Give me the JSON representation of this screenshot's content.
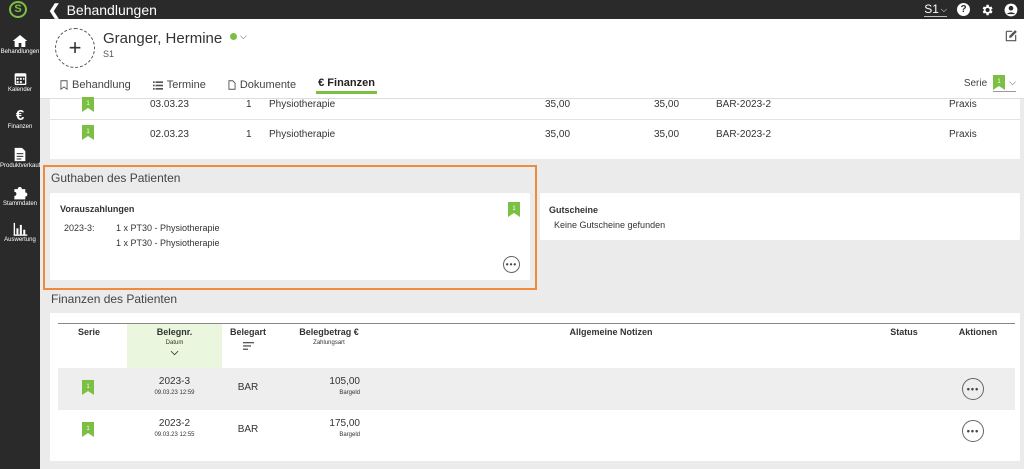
{
  "app": {
    "logo_letter": "S",
    "back_label": "Behandlungen",
    "user_selector": "S1",
    "icons": [
      "back-chevron-icon",
      "help-icon",
      "gear-icon",
      "user-icon"
    ]
  },
  "sidebar": {
    "items": [
      {
        "label": "Behandlungen",
        "icon": "home-icon"
      },
      {
        "label": "Kalender",
        "icon": "calendar-icon"
      },
      {
        "label": "Finanzen",
        "icon": "euro-icon"
      },
      {
        "label": "Produktverkauf",
        "icon": "document-icon"
      },
      {
        "label": "Stammdaten",
        "icon": "puzzle-icon"
      },
      {
        "label": "Auswertung",
        "icon": "bar-chart-icon"
      }
    ]
  },
  "patient": {
    "name": "Granger, Hermine",
    "code": "S1",
    "status_color": "#7bc043"
  },
  "tabs": [
    {
      "label": "Behandlung",
      "icon": "bookmark-outline-icon"
    },
    {
      "label": "Termine",
      "icon": "list-icon"
    },
    {
      "label": "Dokumente",
      "icon": "file-icon"
    },
    {
      "label": "€ Finanzen",
      "icon": "",
      "active": true
    }
  ],
  "serie": {
    "label": "Serie"
  },
  "top_rows": [
    {
      "date": "03.03.23",
      "qty": "1",
      "desc": "Physiotherapie",
      "price1": "35,00",
      "price2": "35,00",
      "ref": "BAR-2023-2",
      "loc": "Praxis"
    },
    {
      "date": "02.03.23",
      "qty": "1",
      "desc": "Physiotherapie",
      "price1": "35,00",
      "price2": "35,00",
      "ref": "BAR-2023-2",
      "loc": "Praxis"
    }
  ],
  "guthaben": {
    "title": "Guthaben des Patienten",
    "voraus": {
      "title": "Vorauszahlungen",
      "label": "2023-3:",
      "items": [
        "1 x PT30 - Physiotherapie",
        "1 x PT30 - Physiotherapie"
      ]
    },
    "gutscheine": {
      "title": "Gutscheine",
      "text": "Keine Gutscheine gefunden"
    }
  },
  "finanzen": {
    "title": "Finanzen des Patienten",
    "headers": {
      "serie": "Serie",
      "belegnr": "Belegnr.",
      "belegnr_sub": "Datum",
      "belegart": "Belegart",
      "betrag": "Belegbetrag €",
      "betrag_sub": "Zahlungsart",
      "notizen": "Allgemeine Notizen",
      "status": "Status",
      "aktionen": "Aktionen"
    },
    "rows": [
      {
        "nr": "2023-3",
        "date": "09.03.23 12:59",
        "art": "BAR",
        "amount": "105,00",
        "pay": "Bargeld"
      },
      {
        "nr": "2023-2",
        "date": "09.03.23 12:55",
        "art": "BAR",
        "amount": "175,00",
        "pay": "Bargeld"
      }
    ]
  },
  "colors": {
    "accent": "#7bc043",
    "highlight": "#f08a3c",
    "dark": "#2a2a2a"
  }
}
